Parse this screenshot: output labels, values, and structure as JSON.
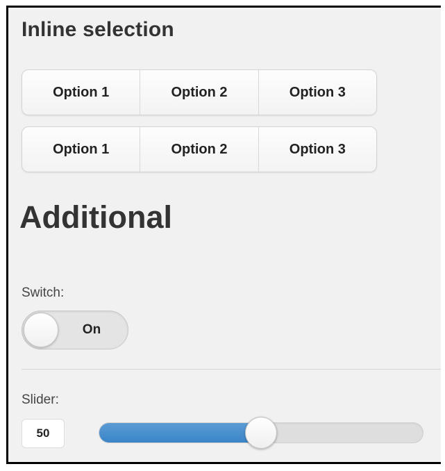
{
  "inline_selection": {
    "heading": "Inline selection",
    "group_1": {
      "options": [
        "Option 1",
        "Option 2",
        "Option 3"
      ]
    },
    "group_2": {
      "options": [
        "Option 1",
        "Option 2",
        "Option 3"
      ]
    }
  },
  "additional": {
    "heading": "Additional",
    "switch": {
      "label": "Switch:",
      "state_text": "On",
      "is_on": true
    },
    "slider": {
      "label": "Slider:",
      "value": "50",
      "min": 0,
      "max": 100
    }
  },
  "colors": {
    "background": "#f1f1f1",
    "slider_fill": "#4a90cf",
    "heading_text": "#333333"
  }
}
